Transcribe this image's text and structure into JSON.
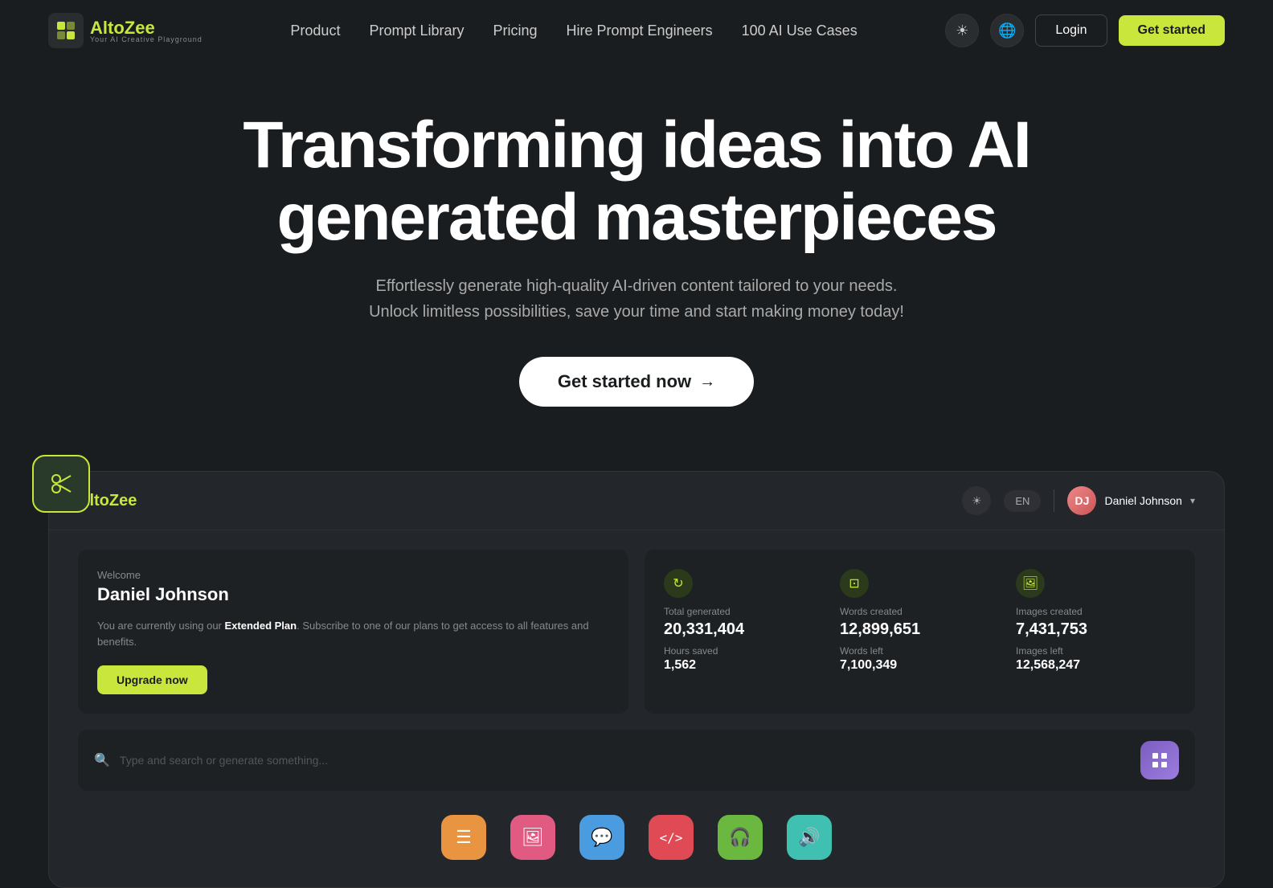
{
  "nav": {
    "logo": {
      "prefix": "Al",
      "highlight": "to",
      "suffix": "Zee",
      "sub": "Your AI Creative Playground"
    },
    "links": [
      {
        "id": "product",
        "label": "Product"
      },
      {
        "id": "prompt-library",
        "label": "Prompt Library"
      },
      {
        "id": "pricing",
        "label": "Pricing"
      },
      {
        "id": "hire-prompt-engineers",
        "label": "Hire Prompt Engineers"
      },
      {
        "id": "100-ai-use-cases",
        "label": "100 AI Use Cases"
      }
    ],
    "theme_icon": "☀",
    "lang_icon": "🌐",
    "login_label": "Login",
    "get_started_label": "Get started"
  },
  "hero": {
    "title_line1": "Transforming ideas into AI",
    "title_line2": "generated masterpieces",
    "subtitle": "Effortlessly generate high-quality AI-driven content tailored to your needs. Unlock limitless possibilities, save your time and start making money today!",
    "cta_label": "Get started now",
    "cta_arrow": "→"
  },
  "corner_badge": {
    "icon": "✂"
  },
  "dashboard": {
    "logo": {
      "prefix": "Al",
      "highlight": "to",
      "suffix": "Zee"
    },
    "header": {
      "theme_icon": "☀",
      "lang_label": "EN",
      "user_name": "Daniel Johnson",
      "user_initials": "DJ"
    },
    "welcome": {
      "label": "Welcome",
      "name": "Daniel Johnson",
      "desc_prefix": "You are currently using our ",
      "desc_bold": "Extended Plan",
      "desc_suffix": ". Subscribe to one of our plans to get access to all features and benefits.",
      "upgrade_label": "Upgrade now"
    },
    "stats": [
      {
        "icon": "↻",
        "main_label": "Total generated",
        "main_value": "20,331,404",
        "sub_label": "Hours saved",
        "sub_value": "1,562"
      },
      {
        "icon": "⊡",
        "main_label": "Words created",
        "main_value": "12,899,651",
        "sub_label": "Words left",
        "sub_value": "7,100,349"
      },
      {
        "icon": "🖼",
        "main_label": "Images created",
        "main_value": "7,431,753",
        "sub_label": "Images left",
        "sub_value": "12,568,247"
      }
    ],
    "search": {
      "placeholder": "Type and search or generate something..."
    },
    "tools": [
      {
        "id": "text",
        "icon": "≡",
        "color": "tool-orange"
      },
      {
        "id": "image",
        "icon": "🖼",
        "color": "tool-pink"
      },
      {
        "id": "chat",
        "icon": "💬",
        "color": "tool-blue"
      },
      {
        "id": "code",
        "icon": "⟨/⟩",
        "color": "tool-red"
      },
      {
        "id": "audio",
        "icon": "🎧",
        "color": "tool-green"
      },
      {
        "id": "voice",
        "icon": "🔊",
        "color": "tool-teal"
      }
    ]
  }
}
